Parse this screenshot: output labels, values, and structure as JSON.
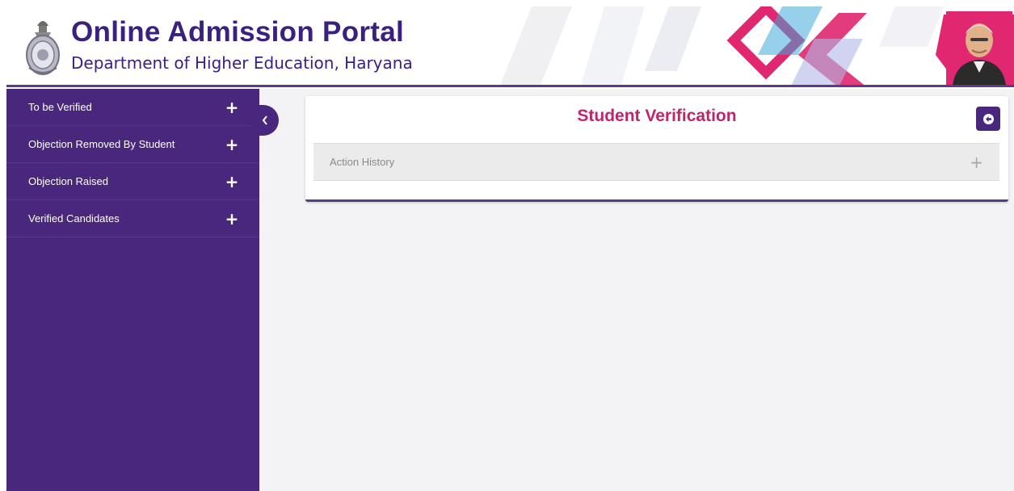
{
  "header": {
    "title": "Online Admission Portal",
    "subtitle": "Department of Higher Education, Haryana",
    "emblem_icon": "state-emblem-icon",
    "portrait_icon": "official-portrait-icon",
    "colors": {
      "title": "#3a2180",
      "accent_pink": "#e0276f",
      "accent_blue": "#3fa9d9"
    }
  },
  "sidebar": {
    "background": "#48277d",
    "items": [
      {
        "label": "To be Verified",
        "icon": "plus-icon"
      },
      {
        "label": "Objection Removed By Student",
        "icon": "plus-icon"
      },
      {
        "label": "Objection Raised",
        "icon": "plus-icon"
      },
      {
        "label": "Verified Candidates",
        "icon": "plus-icon"
      }
    ],
    "collapse_icon": "chevron-left-icon"
  },
  "main": {
    "card": {
      "title": "Student Verification",
      "back_icon": "back-arrow-circle-icon",
      "accordion": {
        "label": "Action History",
        "icon": "plus-icon"
      }
    },
    "colors": {
      "title": "#c0246c",
      "button": "#48277d"
    }
  }
}
